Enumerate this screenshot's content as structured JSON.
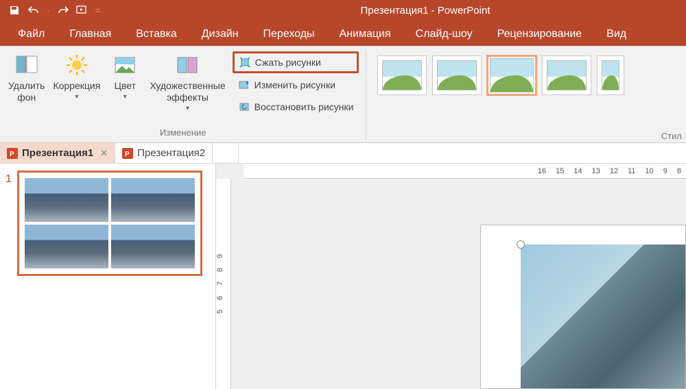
{
  "title": "Презентация1 - PowerPoint",
  "menu": [
    "Файл",
    "Главная",
    "Вставка",
    "Дизайн",
    "Переходы",
    "Анимация",
    "Слайд-шоу",
    "Рецензирование",
    "Вид"
  ],
  "ribbon": {
    "remove_bg": "Удалить\nфон",
    "corrections": "Коррекция",
    "color": "Цвет",
    "artistic": "Художественные\nэффекты",
    "group_adjust": "Изменение",
    "compress": "Сжать рисунки",
    "change": "Изменить рисунки",
    "reset": "Восстановить рисунки",
    "styles_label": "Стил"
  },
  "docs": {
    "tab1": "Презентация1",
    "tab2": "Презентация2"
  },
  "thumbs": {
    "n1": "1"
  },
  "ruler_h": [
    "16",
    "15",
    "14",
    "13",
    "12",
    "11",
    "10",
    "9",
    "8"
  ],
  "ruler_v": [
    "9",
    "8",
    "7",
    "6",
    "5"
  ]
}
